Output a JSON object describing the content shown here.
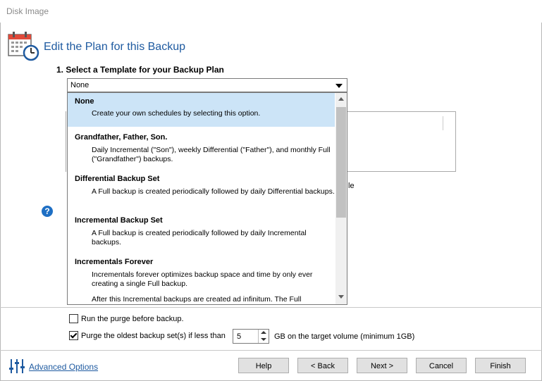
{
  "window": {
    "title": "Disk Image"
  },
  "header": {
    "title": "Edit the Plan for this Backup"
  },
  "step1": {
    "label": "1. Select a Template for your Backup Plan"
  },
  "template_combo": {
    "value": "None"
  },
  "background": {
    "partial_text": "le"
  },
  "templates": [
    {
      "name": "None",
      "desc": "Create your own schedules by selecting this option."
    },
    {
      "name": "Grandfather, Father, Son.",
      "desc": "Daily Incremental (\"Son\"), weekly Differential (\"Father\"), and monthly Full (\"Grandfather\") backups."
    },
    {
      "name": "Differential Backup Set",
      "desc": "A Full backup is created periodically followed by daily Differential backups."
    },
    {
      "name": "Incremental Backup Set",
      "desc": "A Full backup is created periodically followed by daily Incremental backups."
    },
    {
      "name": "Incrementals Forever",
      "desc": "Incrementals forever optimizes backup space and time by only ever creating a single Full backup.",
      "desc2": "After this Incremental backups are created ad infinitum. The Full"
    }
  ],
  "options": {
    "purge_before": {
      "label": "Run the purge before backup.",
      "checked": false
    },
    "purge_oldest": {
      "label": "Purge the oldest backup set(s) if less than",
      "checked": true,
      "value": "5",
      "suffix": "GB on the target volume (minimum 1GB)"
    }
  },
  "footer": {
    "advanced_link": "Advanced Options",
    "buttons": {
      "help": "Help",
      "back": "< Back",
      "next": "Next >",
      "cancel": "Cancel",
      "finish": "Finish"
    }
  },
  "colors": {
    "accent": "#1e5aa0",
    "selection": "#cce4f7"
  }
}
